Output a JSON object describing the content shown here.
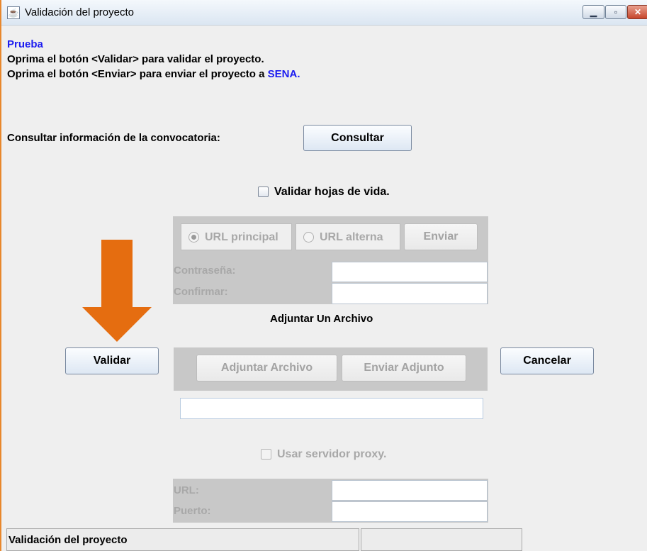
{
  "window": {
    "title": "Validación del proyecto",
    "app_icon": "java-icon",
    "controls": {
      "minimize": "minimize-icon",
      "maximize": "maximize-icon",
      "close": "close-icon"
    }
  },
  "intro": {
    "heading": "Prueba",
    "line1": "Oprima el botón <Validar> para validar el proyecto.",
    "line2_prefix": "Oprima el botón <Enviar> para enviar el proyecto a ",
    "line2_target": "SENA."
  },
  "consult": {
    "label": "Consultar información de la convocatoria:",
    "button": "Consultar"
  },
  "validate_cv": {
    "label": "Validar hojas de vida.",
    "checked": false
  },
  "url_panel": {
    "primary": "URL principal",
    "primary_selected": true,
    "alternate": "URL alterna",
    "send": "Enviar",
    "password_label": "Contraseña:",
    "password_value": "",
    "confirm_label": "Confirmar:",
    "confirm_value": ""
  },
  "attach": {
    "title": "Adjuntar Un Archivo",
    "attach_button": "Adjuntar Archivo",
    "send_button": "Enviar Adjunto",
    "path_value": ""
  },
  "actions": {
    "validate": "Validar",
    "cancel": "Cancelar"
  },
  "proxy": {
    "label": "Usar servidor proxy.",
    "checked": false,
    "url_label": "URL:",
    "url_value": "",
    "port_label": "Puerto:",
    "port_value": ""
  },
  "status": {
    "text": "Validación del proyecto",
    "secondary": ""
  },
  "annotation": {
    "arrow_color": "#e56d10"
  }
}
